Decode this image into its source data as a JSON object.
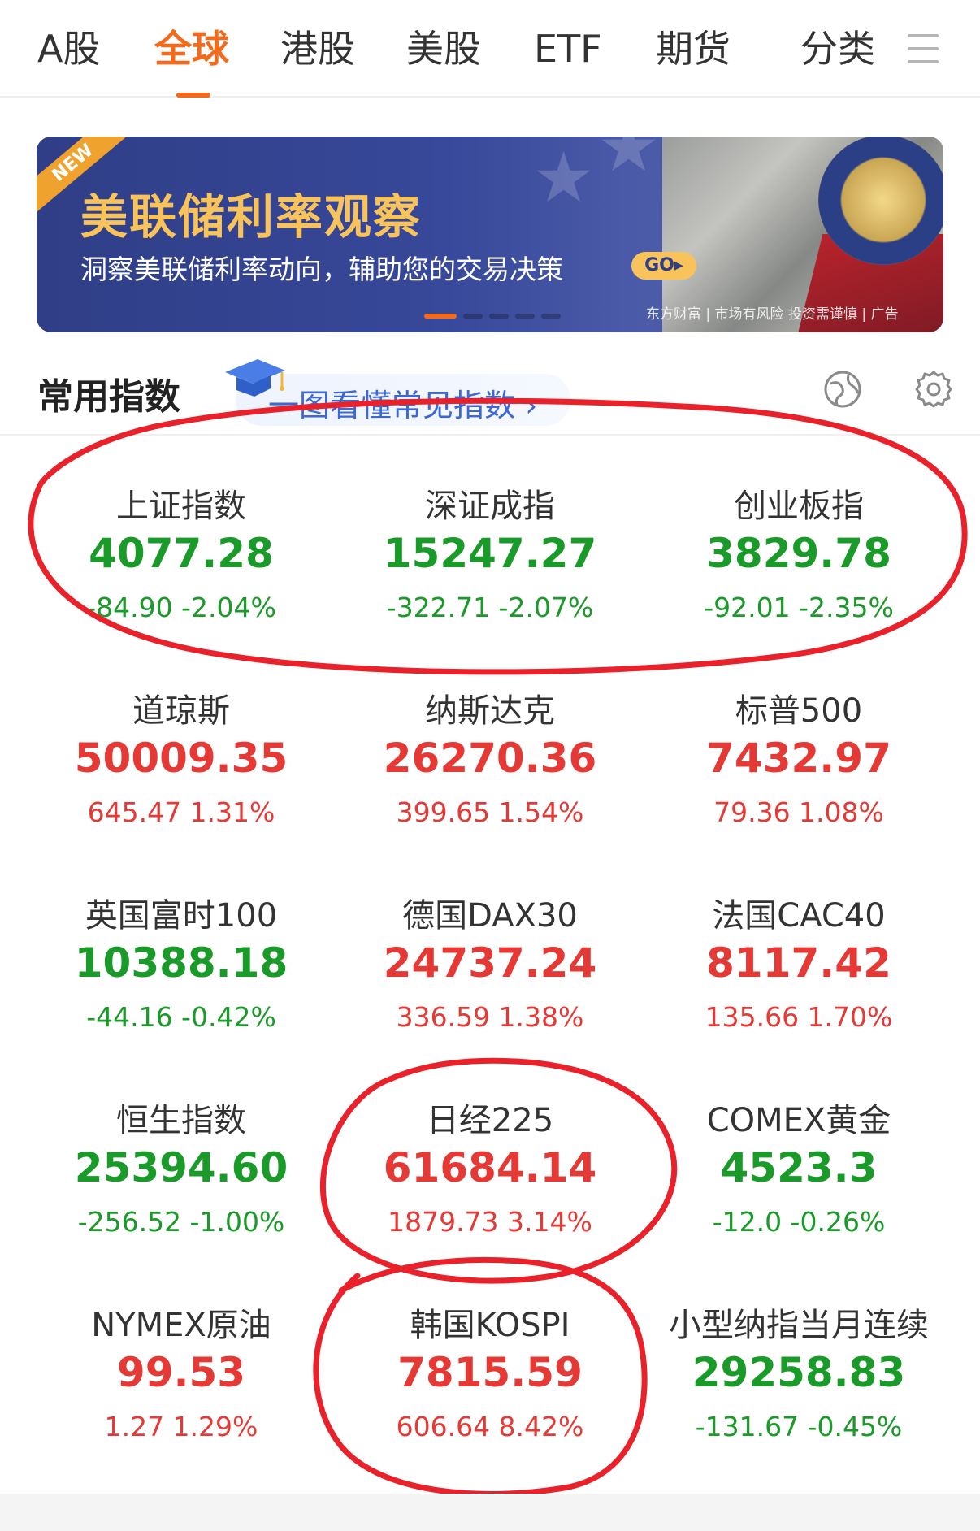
{
  "tabs": [
    {
      "label": "A股",
      "active": false
    },
    {
      "label": "全球",
      "active": true
    },
    {
      "label": "港股",
      "active": false
    },
    {
      "label": "美股",
      "active": false
    },
    {
      "label": "ETF",
      "active": false
    },
    {
      "label": "期货",
      "active": false
    },
    {
      "label": "分类",
      "active": false
    }
  ],
  "banner": {
    "ribbon": "NEW",
    "title": "美联储利率观察",
    "subtitle": "洞察美联储利率动向，辅助您的交易决策",
    "go": "GO▸",
    "ad_note": "东方财富 | 市场有风险 投资需谨慎 | 广告"
  },
  "section": {
    "title": "常用指数",
    "guide": "一图看懂常见指数 ›"
  },
  "colors": {
    "accent": "#f26b1c",
    "up": "#e53935",
    "down": "#1a9a28",
    "annotation": "#e8212b"
  },
  "indices": [
    {
      "name": "上证指数",
      "price": "4077.28",
      "change": "-84.90  -2.04%",
      "trend": "down"
    },
    {
      "name": "深证成指",
      "price": "15247.27",
      "change": "-322.71  -2.07%",
      "trend": "down"
    },
    {
      "name": "创业板指",
      "price": "3829.78",
      "change": "-92.01  -2.35%",
      "trend": "down"
    },
    {
      "name": "道琼斯",
      "price": "50009.35",
      "change": "645.47  1.31%",
      "trend": "up"
    },
    {
      "name": "纳斯达克",
      "price": "26270.36",
      "change": "399.65  1.54%",
      "trend": "up"
    },
    {
      "name": "标普500",
      "price": "7432.97",
      "change": "79.36  1.08%",
      "trend": "up"
    },
    {
      "name": "英国富时100",
      "price": "10388.18",
      "change": "-44.16  -0.42%",
      "trend": "down"
    },
    {
      "name": "德国DAX30",
      "price": "24737.24",
      "change": "336.59  1.38%",
      "trend": "up"
    },
    {
      "name": "法国CAC40",
      "price": "8117.42",
      "change": "135.66  1.70%",
      "trend": "up"
    },
    {
      "name": "恒生指数",
      "price": "25394.60",
      "change": "-256.52  -1.00%",
      "trend": "down"
    },
    {
      "name": "日经225",
      "price": "61684.14",
      "change": "1879.73  3.14%",
      "trend": "up"
    },
    {
      "name": "COMEX黄金",
      "price": "4523.3",
      "change": "-12.0  -0.26%",
      "trend": "down"
    },
    {
      "name": "NYMEX原油",
      "price": "99.53",
      "change": "1.27  1.29%",
      "trend": "up"
    },
    {
      "name": "韩国KOSPI",
      "price": "7815.59",
      "change": "606.64  8.42%",
      "trend": "up"
    },
    {
      "name": "小型纳指当月连续",
      "price": "29258.83",
      "change": "-131.67  -0.45%",
      "trend": "down"
    }
  ]
}
